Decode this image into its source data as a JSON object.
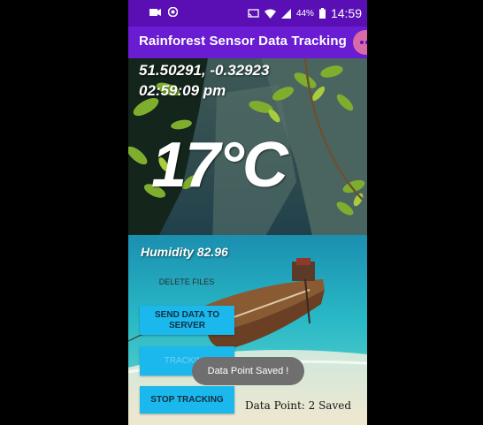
{
  "statusbar": {
    "battery_pct": "44%",
    "time": "14:59"
  },
  "appbar": {
    "title": "Rainforest Sensor Data Tracking"
  },
  "sensor": {
    "coordinates": "51.50291, -0.32923",
    "time": "02:59:09 pm",
    "temperature": "17°C",
    "humidity": "Humidity 82.96"
  },
  "buttons": {
    "delete": "DELETE FILES",
    "send": "SEND DATA TO SERVER",
    "tracking": "TRACKING",
    "stop": "STOP TRACKING"
  },
  "toast": {
    "message": "Data Point Saved !"
  },
  "status": {
    "data_point": "Data Point: 2 Saved"
  },
  "colors": {
    "status_bar": "#5a0fb5",
    "app_bar": "#6a1cd3",
    "button": "#1ab8ec"
  },
  "icons": [
    "video-icon",
    "chrome-icon",
    "cast-icon",
    "wifi-icon",
    "signal-icon",
    "battery-icon"
  ]
}
